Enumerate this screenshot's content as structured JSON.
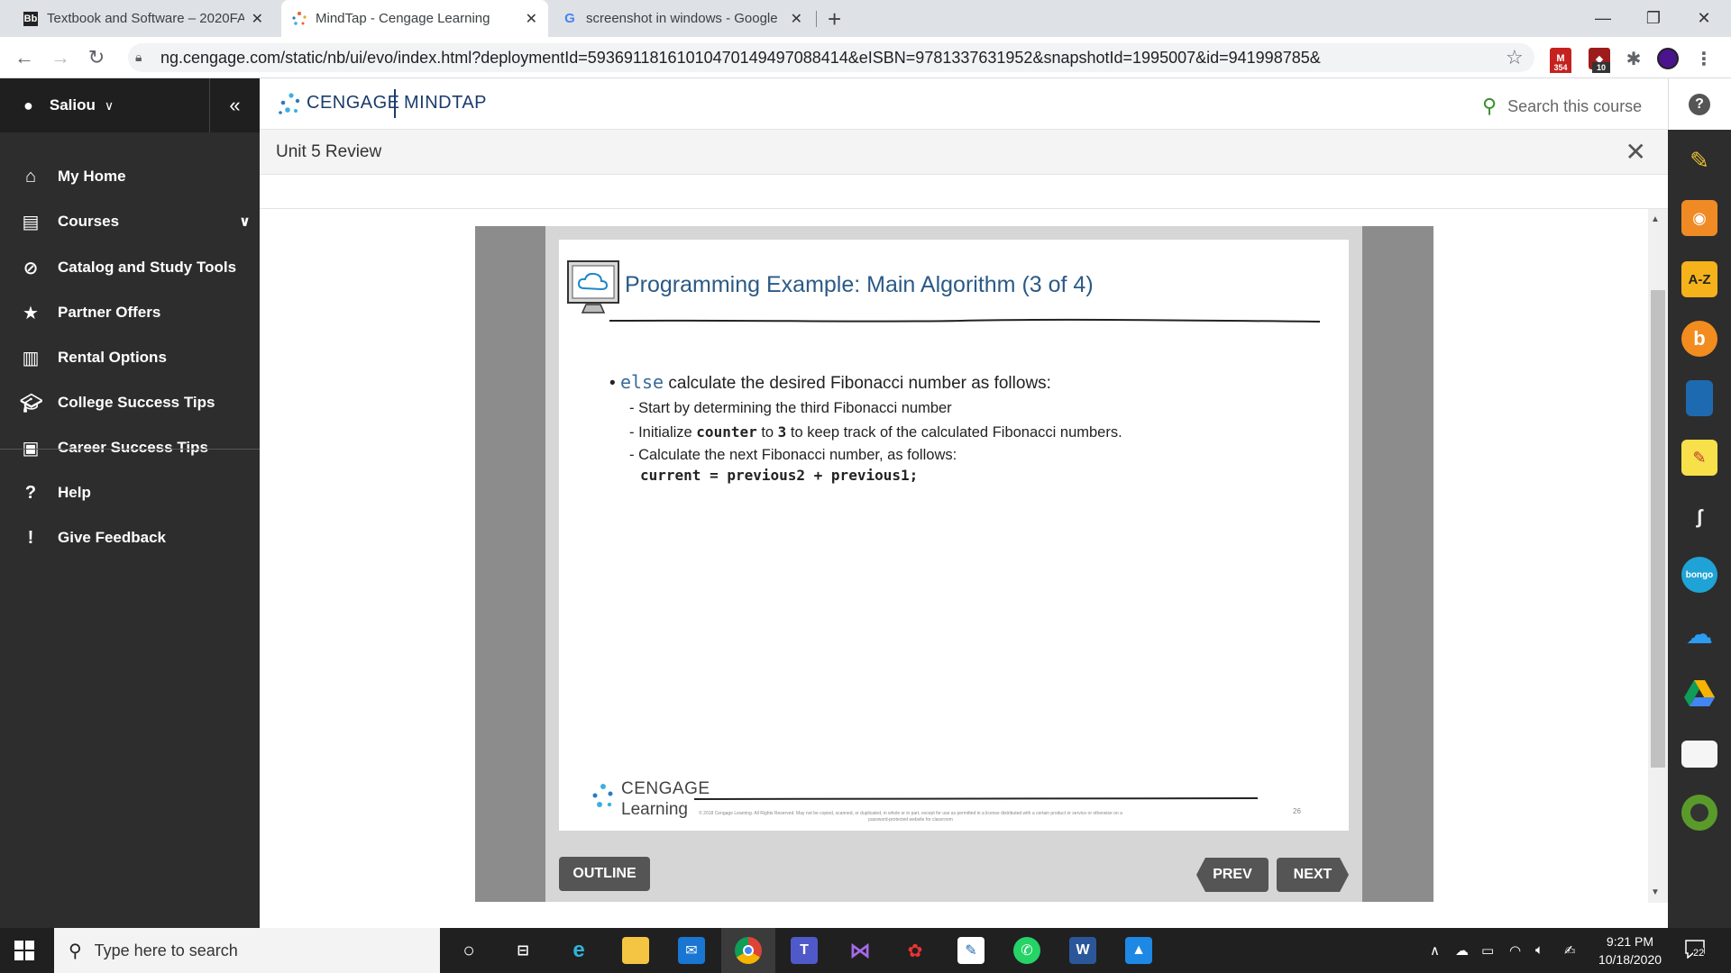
{
  "browser": {
    "tabs": [
      {
        "favicon": "Bb",
        "title": "Textbook and Software – 2020FA"
      },
      {
        "favicon": "cengage-dots",
        "title": "MindTap - Cengage Learning"
      },
      {
        "favicon": "G",
        "title": "screenshot in windows - Google"
      }
    ],
    "url": "ng.cengage.com/static/nb/ui/evo/index.html?deploymentId=59369118161010470149497088414&eISBN=9781337631952&snapshotId=1995007&id=941998785&",
    "extensions": {
      "gmail_badge": "354",
      "ext2_badge": "10"
    }
  },
  "sidebar": {
    "user": "Saliou",
    "items": [
      {
        "label": "My Home",
        "icon": "home-icon"
      },
      {
        "label": "Courses",
        "icon": "book-icon"
      },
      {
        "label": "Catalog and Study Tools",
        "icon": "compass-icon"
      },
      {
        "label": "Partner Offers",
        "icon": "star-icon"
      },
      {
        "label": "Rental Options",
        "icon": "open-book-icon"
      },
      {
        "label": "College Success Tips",
        "icon": "graduation-cap-icon"
      },
      {
        "label": "Career Success Tips",
        "icon": "briefcase-icon"
      },
      {
        "label": "Help",
        "icon": "question-icon"
      },
      {
        "label": "Give Feedback",
        "icon": "feedback-icon"
      }
    ]
  },
  "header": {
    "brand": "CENGAGE",
    "product": "MINDTAP",
    "search_placeholder": "Search this course"
  },
  "activity": {
    "title": "Unit 5 Review"
  },
  "slide": {
    "title": "Programming Example: Main Algorithm (3 of 4)",
    "bullet_kw": "else",
    "bullet_text": " calculate the desired Fibonacci number as follows:",
    "sub1": "Start by determining the third Fibonacci number",
    "sub2_pre": "Initialize ",
    "sub2_code1": "counter",
    "sub2_mid": " to ",
    "sub2_code2": "3",
    "sub2_post": " to keep track of the calculated Fibonacci numbers.",
    "sub3": "Calculate the next Fibonacci number, as follows:",
    "code": "current = previous2 + previous1;",
    "footer_brand1": "CENGAGE",
    "footer_brand2": "Learning",
    "copyright": "© 2018 Cengage Learning. All Rights Reserved. May not be copied, scanned, or duplicated, in whole or in part, except for use as permitted in a license distributed with a certain product or service or otherwise on a password-protected website for classroom",
    "page_number": "26"
  },
  "controls": {
    "outline": "OUTLINE",
    "prev": "PREV",
    "next": "NEXT"
  },
  "dock": [
    "pencil-icon",
    "rss-icon",
    "a-z-icon",
    "b-icon",
    "notebook-icon",
    "sticky-note-icon",
    "readspeaker-icon",
    "bongo-icon",
    "onedrive-icon",
    "google-drive-icon",
    "notes-icon",
    "green-circle-icon"
  ],
  "dock_labels": {
    "az": "A-Z",
    "bongo": "bongo"
  },
  "taskbar": {
    "search_placeholder": "Type here to search",
    "time": "9:21 PM",
    "date": "10/18/2020",
    "notifications": "22"
  }
}
